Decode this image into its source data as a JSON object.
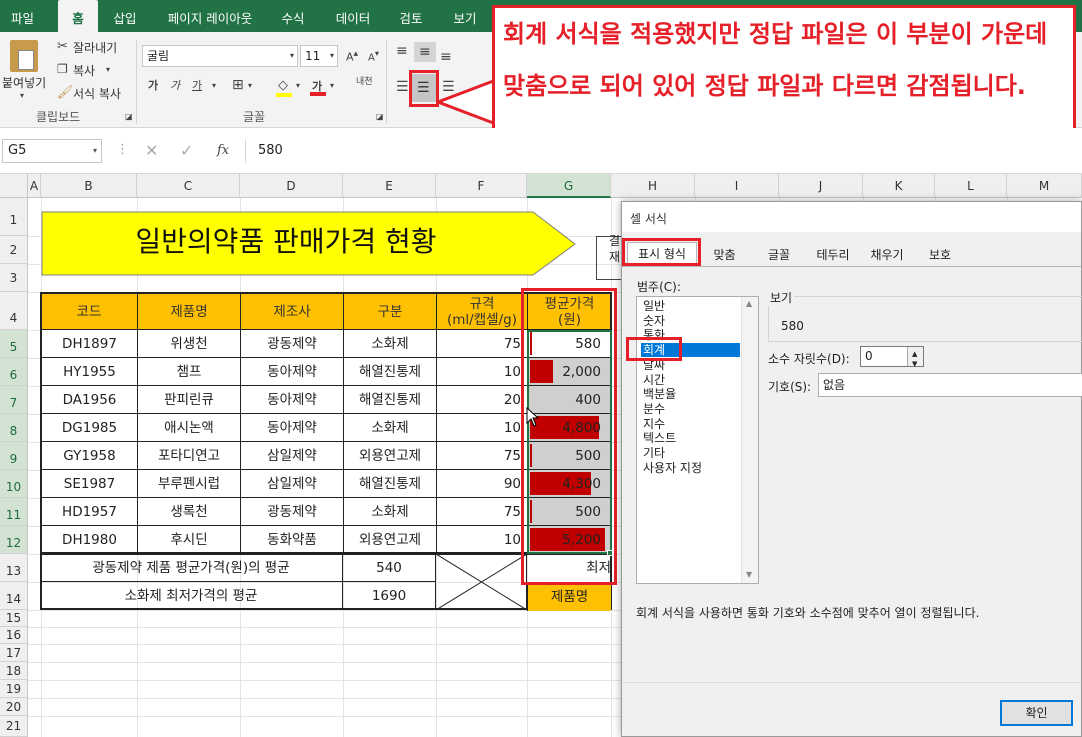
{
  "ribbon": {
    "tabs": [
      "파일",
      "홈",
      "삽입",
      "페이지 레이아웃",
      "수식",
      "데이터",
      "검토",
      "보기"
    ],
    "clipboard": {
      "paste": "붙여넣기",
      "cut": "잘라내기",
      "copy": "복사",
      "format_painter": "서식 복사",
      "group": "클립보드"
    },
    "font": {
      "name": "굴림",
      "size": "11",
      "group": "글꼴",
      "bold": "가",
      "italic": "가",
      "underline": "가",
      "font_color_glyph": "가",
      "phonetic": "내천"
    }
  },
  "callout": {
    "text": "회계 서식을 적용했지만 정답 파일은 이 부분이 가운데 맞춤으로 되어 있어 정답 파일과 다르면 감점됩니다."
  },
  "formula_bar": {
    "name_box": "G5",
    "fx": "fx",
    "value": "580"
  },
  "columns": [
    "A",
    "B",
    "C",
    "D",
    "E",
    "F",
    "G",
    "H",
    "I",
    "J",
    "K",
    "L",
    "M"
  ],
  "rows": [
    "1",
    "2",
    "3",
    "4",
    "5",
    "6",
    "7",
    "8",
    "9",
    "10",
    "11",
    "12",
    "13",
    "14",
    "15",
    "16",
    "17",
    "18",
    "19",
    "20",
    "21"
  ],
  "sheet": {
    "title": "일반의약품 판매가격 현황",
    "approval_fragments": [
      "결",
      "재"
    ],
    "headers": {
      "code": "코드",
      "product": "제품명",
      "maker": "제조사",
      "type": "구분",
      "spec1": "규격",
      "spec2": "(ml/캡셀/g)",
      "price1": "평균가격",
      "price2": "(원)"
    },
    "data_rows": [
      {
        "code": "DH1897",
        "product": "위생천",
        "maker": "광동제약",
        "type": "소화제",
        "spec": "75",
        "price": "580",
        "bar": 0.03
      },
      {
        "code": "HY1955",
        "product": "챔프",
        "maker": "동아제약",
        "type": "해열진통제",
        "spec": "10",
        "price": "2,000",
        "bar": 0.3
      },
      {
        "code": "DA1956",
        "product": "판피린큐",
        "maker": "동아제약",
        "type": "해열진통제",
        "spec": "20",
        "price": "400",
        "bar": 0.0
      },
      {
        "code": "DG1985",
        "product": "애시논액",
        "maker": "동아제약",
        "type": "소화제",
        "spec": "10",
        "price": "4,800",
        "bar": 0.88
      },
      {
        "code": "GY1958",
        "product": "포타디연고",
        "maker": "삼일제약",
        "type": "외용연고제",
        "spec": "75",
        "price": "500",
        "bar": 0.02
      },
      {
        "code": "SE1987",
        "product": "부루펜시럽",
        "maker": "삼일제약",
        "type": "해열진통제",
        "spec": "90",
        "price": "4,300",
        "bar": 0.78
      },
      {
        "code": "HD1957",
        "product": "생록천",
        "maker": "광동제약",
        "type": "소화제",
        "spec": "75",
        "price": "500",
        "bar": 0.02
      },
      {
        "code": "DH1980",
        "product": "후시딘",
        "maker": "동화약품",
        "type": "외용연고제",
        "spec": "10",
        "price": "5,200",
        "bar": 0.96
      }
    ],
    "summary": [
      {
        "label": "광동제약 제품 평균가격(원)의 평균",
        "value": "540"
      },
      {
        "label": "소화제 최저가격의 평균",
        "value": "1690"
      }
    ],
    "g13_text": "최저",
    "g14_text": "제품명"
  },
  "dialog": {
    "title": "셀 서식",
    "tabs": [
      "표시 형식",
      "맞춤",
      "글꼴",
      "테두리",
      "채우기",
      "보호"
    ],
    "category_label": "범주(C):",
    "categories": [
      "일반",
      "숫자",
      "통화",
      "회계",
      "날짜",
      "시간",
      "백분율",
      "분수",
      "지수",
      "텍스트",
      "기타",
      "사용자 지정"
    ],
    "selected_category": "회계",
    "sample_label": "보기",
    "sample_value": "580",
    "decimal_label": "소수 자릿수(D):",
    "decimal_value": "0",
    "symbol_label": "기호(S):",
    "symbol_value": "없음",
    "description": "회계 서식을 사용하면 통화 기호와 소수점에 맞추어 열이 정렬됩니다.",
    "ok": "확인"
  },
  "colors": {
    "excel_green": "#217346",
    "header_fill": "#ffc000",
    "title_fill": "#ffff00",
    "bar_red": "#c00000",
    "accent_red": "#e52028",
    "selection_blue": "#0078d7"
  }
}
